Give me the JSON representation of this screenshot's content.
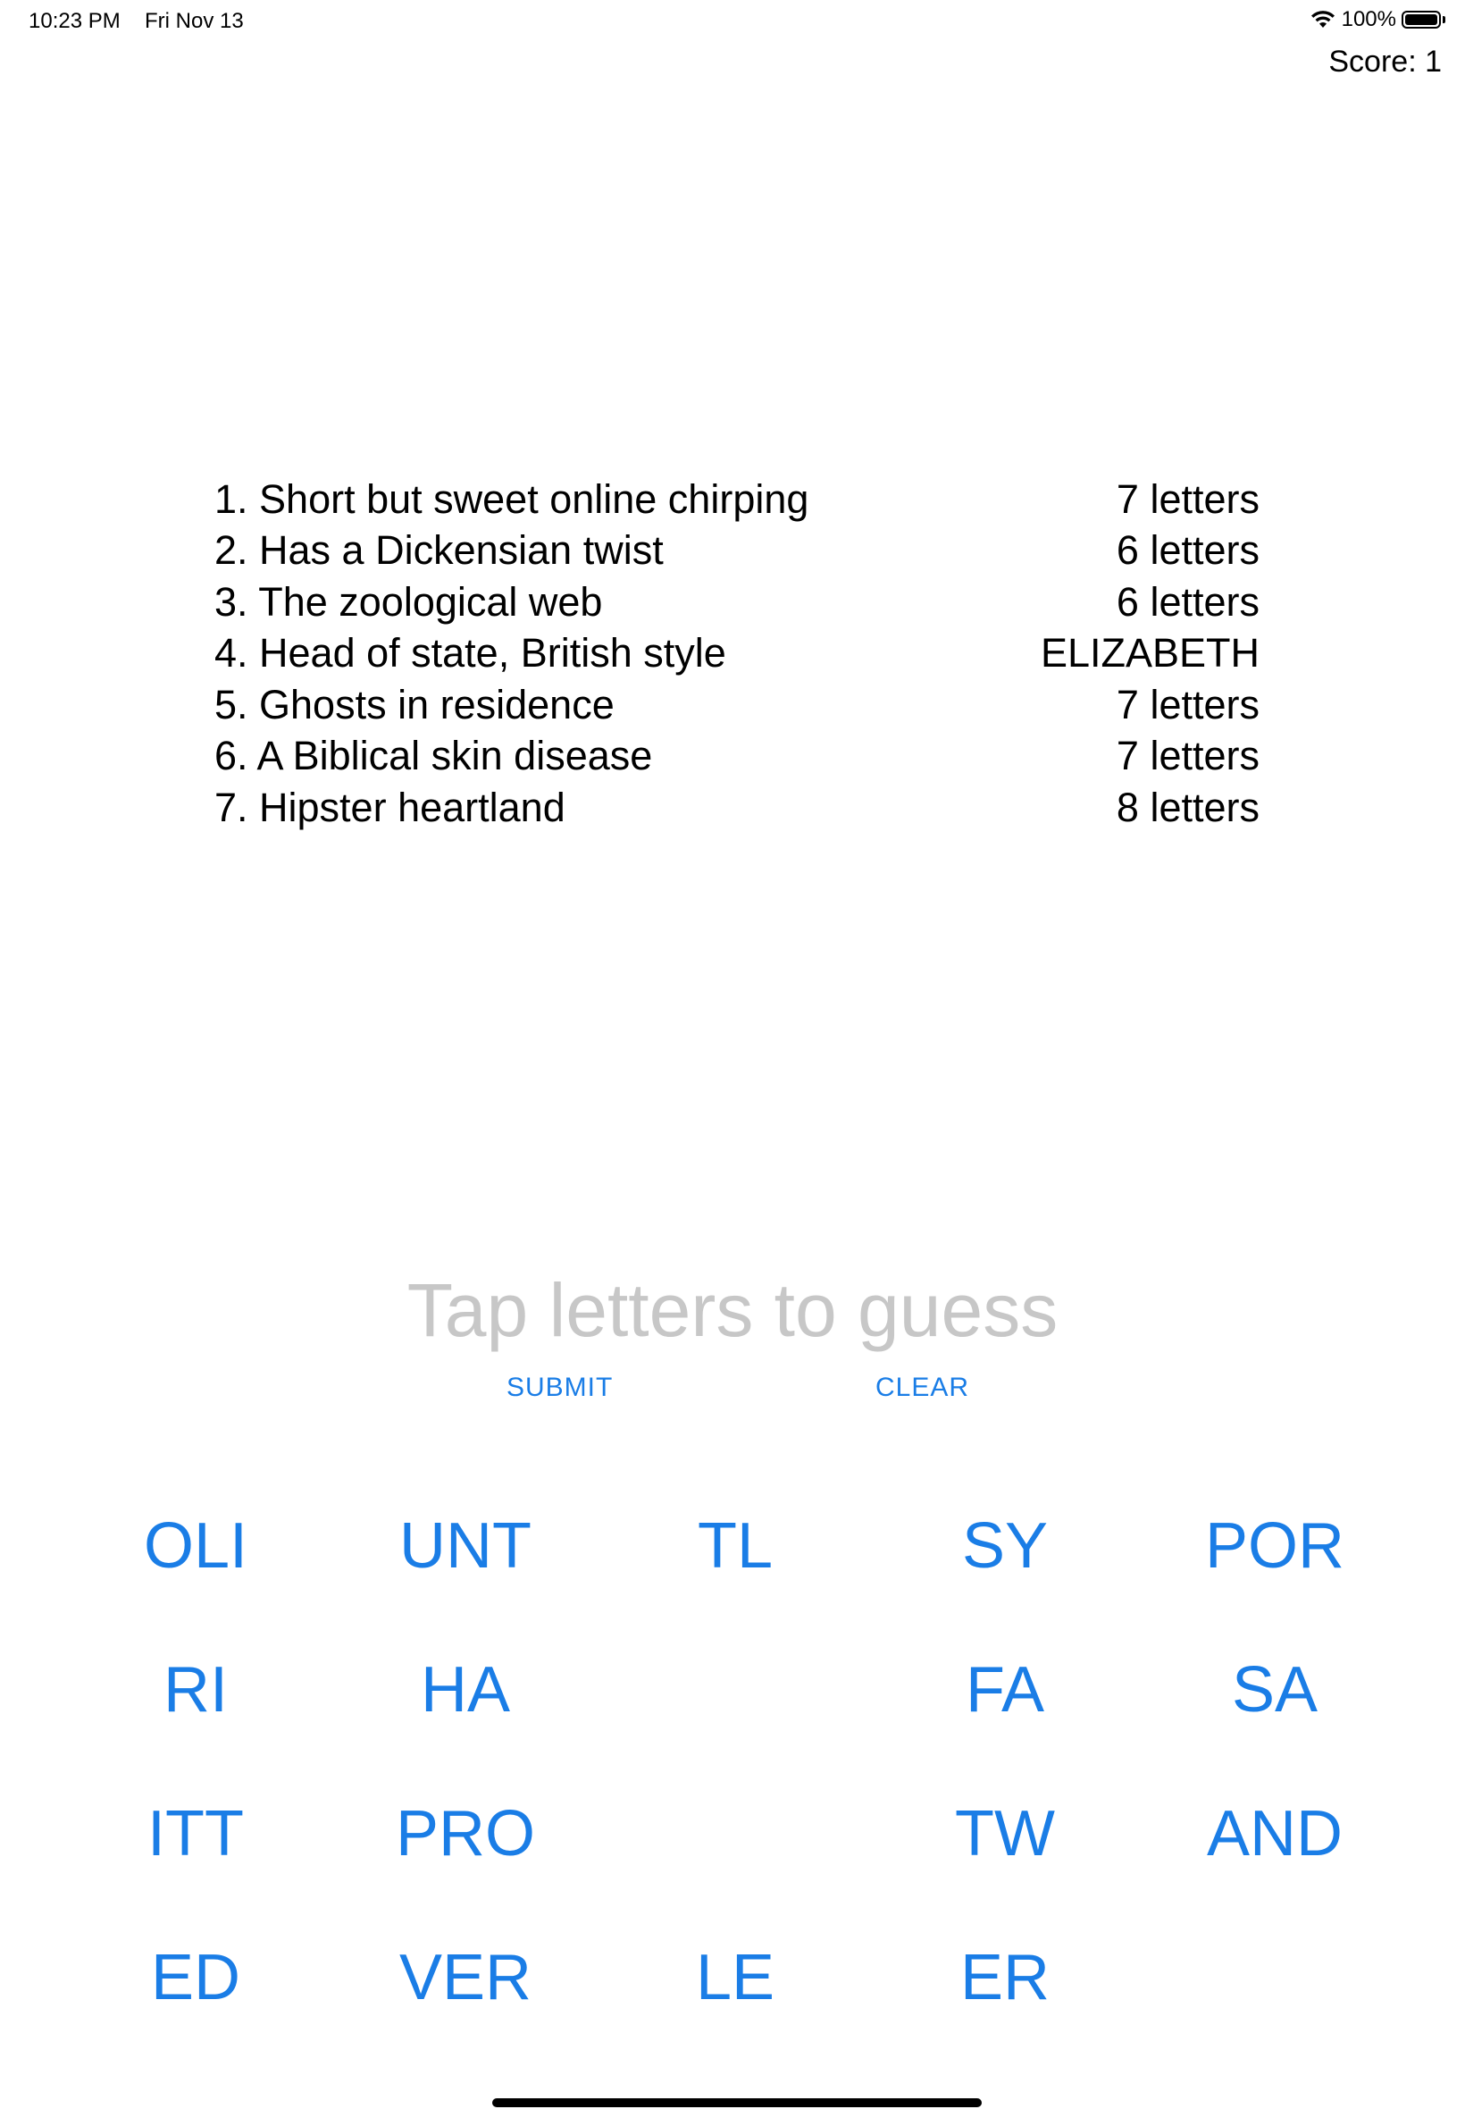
{
  "status_bar": {
    "time": "10:23 PM",
    "date": "Fri Nov 13",
    "battery": "100%",
    "icons": [
      "wifi-icon",
      "battery-icon"
    ]
  },
  "score": "Score: 1",
  "clues": [
    {
      "text": "1. Short but sweet online chirping",
      "hint": "7 letters"
    },
    {
      "text": "2. Has a Dickensian twist",
      "hint": "6 letters"
    },
    {
      "text": "3. The zoological web",
      "hint": "6 letters"
    },
    {
      "text": "4. Head of state, British style",
      "hint": "ELIZABETH"
    },
    {
      "text": "5. Ghosts in residence",
      "hint": "7 letters"
    },
    {
      "text": "6. A Biblical skin disease",
      "hint": "7 letters"
    },
    {
      "text": "7. Hipster heartland",
      "hint": "8 letters"
    }
  ],
  "guess": {
    "placeholder": "Tap letters to guess"
  },
  "actions": {
    "submit": "SUBMIT",
    "clear": "CLEAR"
  },
  "tiles": [
    [
      "OLI",
      "UNT",
      "TL",
      "SY",
      "POR"
    ],
    [
      "RI",
      "HA",
      "",
      "FA",
      "SA"
    ],
    [
      "ITT",
      "PRO",
      "",
      "TW",
      "AND"
    ],
    [
      "ED",
      "VER",
      "LE",
      "ER",
      ""
    ]
  ],
  "colors": {
    "accent": "#1a7de6",
    "placeholder": "#c7c7c7",
    "text": "#000000",
    "background": "#ffffff"
  }
}
